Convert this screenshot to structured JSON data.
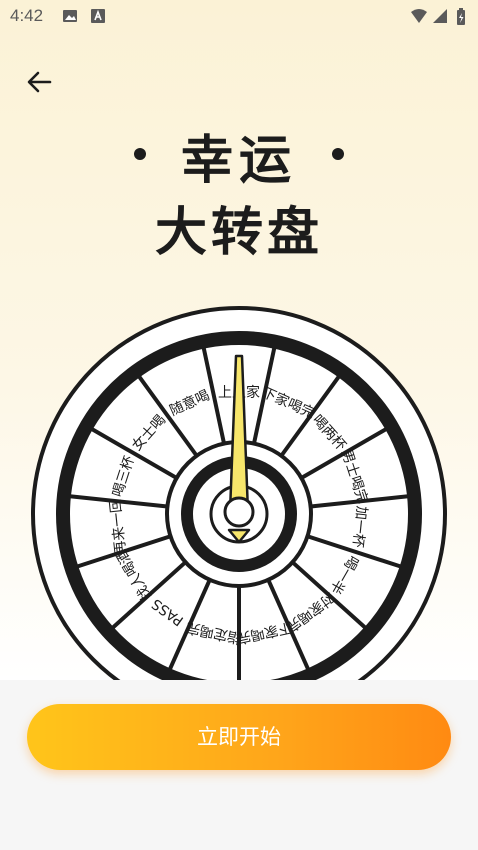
{
  "status_bar": {
    "time": "4:42",
    "icons": [
      "image-icon",
      "text-a-icon",
      "wifi-icon",
      "signal-icon",
      "battery-icon"
    ]
  },
  "header": {
    "back_icon": "back-arrow-icon"
  },
  "title": {
    "line1": "幸运",
    "line2": "大转盘"
  },
  "wheel": {
    "segments": [
      "上上家",
      "下家喝完",
      "喝两杯",
      "男士喝完",
      "加一杯",
      "喝一半",
      "对家喝完",
      "下家喝完",
      "指定喝完",
      "PASS",
      "找人喝酒",
      "再来一回",
      "喝三杯",
      "女士喝",
      "随意喝"
    ]
  },
  "actions": {
    "start_label": "立即开始"
  },
  "colors": {
    "button_start": "#ffc51a",
    "button_end": "#ff8a12",
    "pointer": "#f7e66b",
    "ink": "#1c1c1c"
  }
}
